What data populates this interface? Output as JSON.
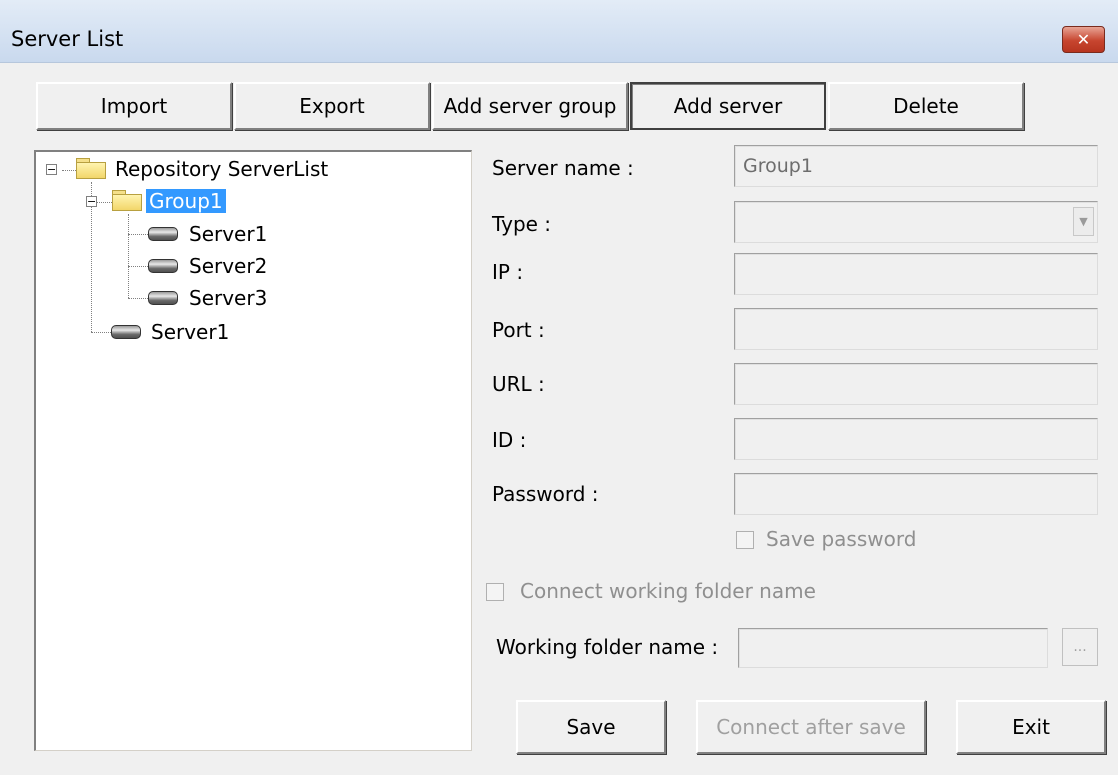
{
  "window": {
    "title": "Server List",
    "close_icon": "close-x-icon"
  },
  "toolbar": {
    "import": "Import",
    "export": "Export",
    "add_server_group": "Add server group",
    "add_server": "Add server",
    "delete": "Delete"
  },
  "tree": {
    "root": "Repository ServerList",
    "group": "Group1",
    "group_servers": [
      "Server1",
      "Server2",
      "Server3"
    ],
    "root_server": "Server1",
    "selected": "Group1"
  },
  "form": {
    "server_name_label": "Server name :",
    "server_name_value": "Group1",
    "type_label": "Type :",
    "type_value": "",
    "ip_label": "IP :",
    "ip_value": "",
    "port_label": "Port :",
    "port_value": "",
    "url_label": "URL :",
    "url_value": "",
    "id_label": "ID :",
    "id_value": "",
    "password_label": "Password :",
    "password_value": "",
    "save_password_label": "Save password",
    "save_password_checked": false,
    "connect_working_folder_label": "Connect working folder name",
    "connect_working_folder_checked": false,
    "working_folder_label": "Working folder name :",
    "working_folder_value": "",
    "browse_label": "..."
  },
  "footer": {
    "save": "Save",
    "connect_after_save": "Connect after save",
    "exit": "Exit"
  },
  "colors": {
    "selection": "#3399ff",
    "titlebar": "#dbe6f4",
    "close": "#c7452f"
  }
}
